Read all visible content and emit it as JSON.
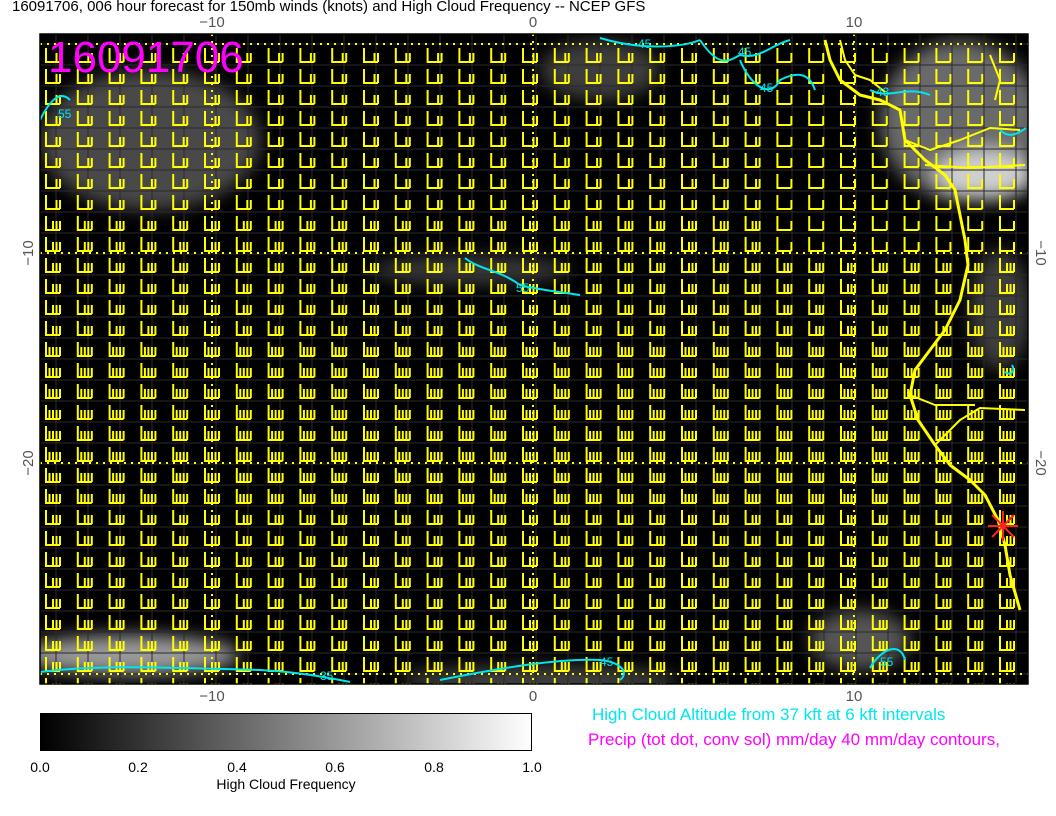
{
  "title": "16091706, 006 hour forecast for 150mb winds (knots) and High Cloud Frequency -- NCEP GFS",
  "stamp": "16091706",
  "axes": {
    "top_ticks": [
      "−10",
      "0",
      "10"
    ],
    "bottom_ticks": [
      "−10",
      "0",
      "10"
    ],
    "left_ticks": [
      "−10",
      "−20"
    ],
    "right_ticks": [
      "−10",
      "−20"
    ]
  },
  "contour_labels": [
    "55",
    "45",
    "45",
    "43",
    "55",
    "45",
    "55",
    "45",
    "35"
  ],
  "colorbar": {
    "label": "High Cloud Frequency",
    "ticks": [
      "0.0",
      "0.2",
      "0.4",
      "0.6",
      "0.8",
      "1.0"
    ]
  },
  "notes": {
    "cloud": "High Cloud Altitude from 37 kft at 6 kft intervals",
    "precip": "Precip (tot dot, conv sol) mm/day 40 mm/day contours,"
  },
  "colors": {
    "background": "#000000",
    "barbs": "#ffff00",
    "coast": "#ffff00",
    "contour": "#00e5ee",
    "stamp": "#ff00ff",
    "marker": "#ff2020"
  },
  "icons": {
    "marker": "red-star-burst-icon"
  }
}
